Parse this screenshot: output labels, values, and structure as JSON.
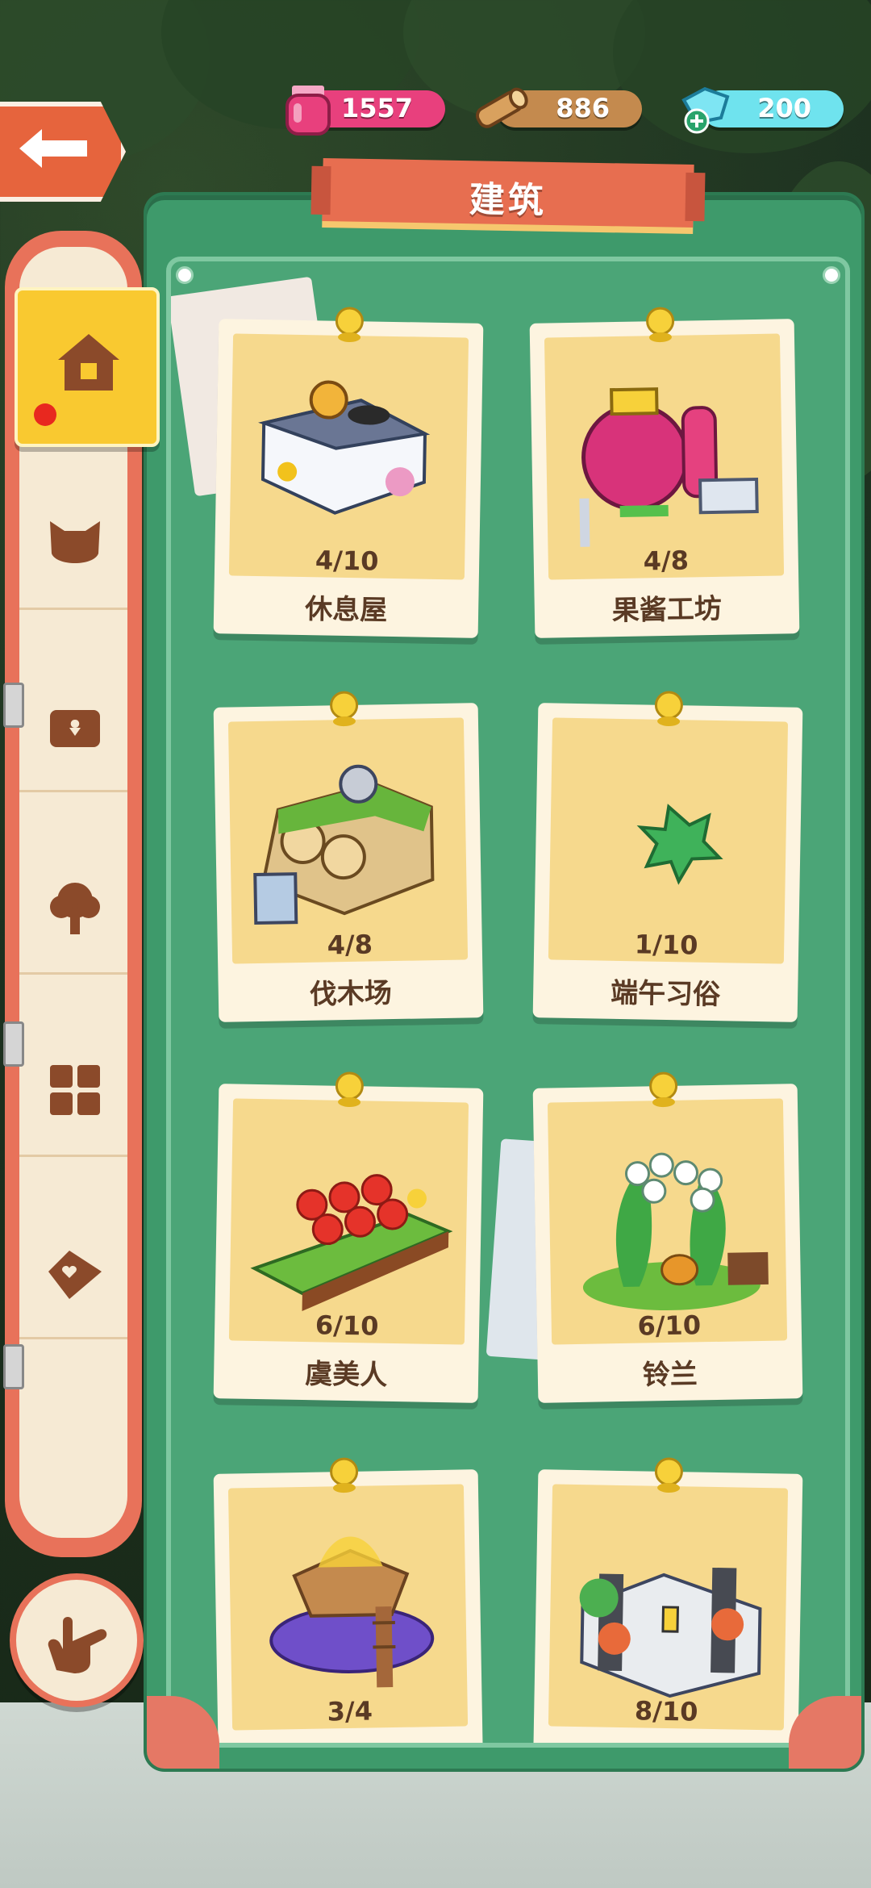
{
  "header": {
    "title": "建筑",
    "back_icon": "back-arrow-icon"
  },
  "resources": [
    {
      "name": "jam",
      "icon": "jam-jar-icon",
      "value": "1557",
      "color": "#e8407d"
    },
    {
      "name": "wood",
      "icon": "wood-log-icon",
      "value": "886",
      "color": "#c48a4e"
    },
    {
      "name": "gem",
      "icon": "crystal-plus-icon",
      "value": "200",
      "color": "#6fe3ee"
    }
  ],
  "sidebar": {
    "items": [
      {
        "icon": "house-icon",
        "selected": true,
        "has_badge": true
      },
      {
        "icon": "cat-head-icon",
        "selected": false
      },
      {
        "icon": "treasure-chest-icon",
        "selected": false
      },
      {
        "icon": "tree-icon",
        "selected": false
      },
      {
        "icon": "grid-icon",
        "selected": false
      },
      {
        "icon": "tag-icon",
        "selected": false
      }
    ],
    "bottom_button_icon": "pointing-hand-icon"
  },
  "buildings": [
    {
      "count": "4/10",
      "name": "休息屋",
      "art": "rest-house-art"
    },
    {
      "count": "4/8",
      "name": "果酱工坊",
      "art": "jam-workshop-art"
    },
    {
      "count": "4/8",
      "name": "伐木场",
      "art": "lumber-yard-art"
    },
    {
      "count": "1/10",
      "name": "端午习俗",
      "art": "leaf-art"
    },
    {
      "count": "6/10",
      "name": "虞美人",
      "art": "poppy-art"
    },
    {
      "count": "6/10",
      "name": "铃兰",
      "art": "lily-of-valley-art"
    },
    {
      "count": "3/4",
      "name": "",
      "art": "treehouse-art"
    },
    {
      "count": "8/10",
      "name": "",
      "art": "garden-wall-art"
    }
  ],
  "colors": {
    "panel_green": "#3e9a6b",
    "accent_orange": "#e76e50",
    "card_yellow": "#f6d98d",
    "selected_tab": "#f9c930"
  }
}
